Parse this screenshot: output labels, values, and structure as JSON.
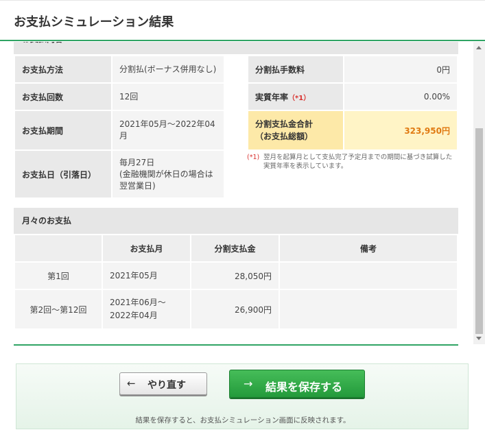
{
  "header": {
    "title": "お支払シミュレーション結果"
  },
  "section_cut_label": "お支払内容",
  "details_left": [
    {
      "key": "お支払方法",
      "value": "分割払(ボーナス併用なし)"
    },
    {
      "key": "お支払回数",
      "value": "12回"
    },
    {
      "key": "お支払期間",
      "value": "2021年05月～2022年04月"
    },
    {
      "key": "お支払日（引落日）",
      "value": "毎月27日\n(金融機関が休日の場合は翌営業日)"
    }
  ],
  "details_right": [
    {
      "key": "分割払手数料",
      "value": "0円"
    },
    {
      "key": "実質年率",
      "key_note": "（*1）",
      "value": "0.00%"
    },
    {
      "key": "分割支払金合計\n（お支払総額）",
      "value": "323,950円"
    }
  ],
  "note": {
    "mark": "(*1)",
    "text": "翌月を起算月として支払完了予定月までの期間に基づき試算した実質年率を表示しています。"
  },
  "monthly": {
    "title": "月々のお支払",
    "headers": [
      "",
      "お支払月",
      "分割支払金",
      "備考"
    ],
    "rows": [
      {
        "label": "第1回",
        "month": "2021年05月",
        "amount": "28,050円",
        "remarks": ""
      },
      {
        "label": "第2回～第12回",
        "month": "2021年06月～\n2022年04月",
        "amount": "26,900円",
        "remarks": ""
      }
    ]
  },
  "footer": {
    "back_label": "やり直す",
    "save_label": "結果を保存する",
    "arrow_back": "←",
    "arrow_save": "→",
    "note": "結果を保存すると、お支払シミュレーション画面に反映されます。"
  },
  "colors": {
    "accent": "#2fa464",
    "highlight_bg": "#fff4c6",
    "highlight_text": "#e07a12",
    "note_red": "#d9322f"
  }
}
